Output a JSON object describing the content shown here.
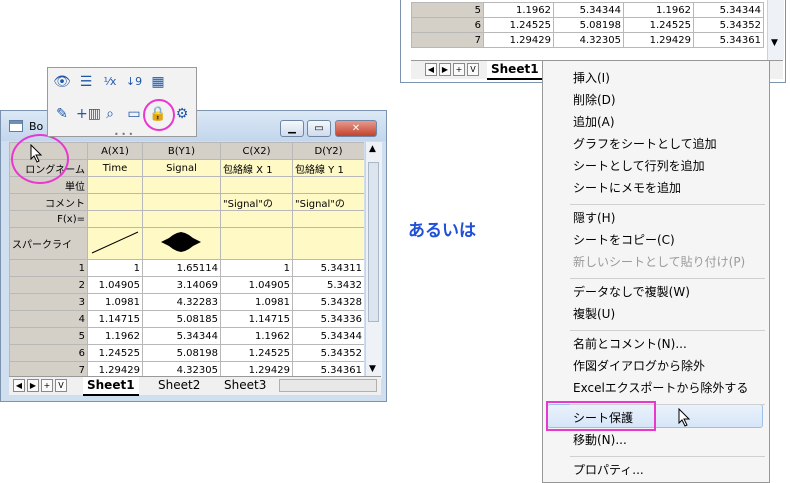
{
  "window": {
    "title_fragment": "Bo"
  },
  "columns": [
    {
      "header": "A(X1)"
    },
    {
      "header": "B(Y1)"
    },
    {
      "header": "C(X2)"
    },
    {
      "header": "D(Y2)"
    }
  ],
  "label_rows": [
    {
      "label": "ロングネーム",
      "a": "Time",
      "b": "Signal",
      "c": "包絡線 X 1",
      "d": "包絡線 Y 1"
    },
    {
      "label": "単位",
      "a": "",
      "b": "",
      "c": "",
      "d": ""
    },
    {
      "label": "コメント",
      "a": "",
      "b": "",
      "c": "\"Signal\"の",
      "d": "\"Signal\"の"
    },
    {
      "label": "F(x)=",
      "a": "",
      "b": "",
      "c": "",
      "d": ""
    }
  ],
  "sparkline_label": "スパークライ",
  "data_rows": [
    {
      "n": "1",
      "a": "1",
      "b": "1.65114",
      "c": "1",
      "d": "5.34311"
    },
    {
      "n": "2",
      "a": "1.04905",
      "b": "3.14069",
      "c": "1.04905",
      "d": "5.3432"
    },
    {
      "n": "3",
      "a": "1.0981",
      "b": "4.32283",
      "c": "1.0981",
      "d": "5.34328"
    },
    {
      "n": "4",
      "a": "1.14715",
      "b": "5.08185",
      "c": "1.14715",
      "d": "5.34336"
    },
    {
      "n": "5",
      "a": "1.1962",
      "b": "5.34344",
      "c": "1.1962",
      "d": "5.34344"
    },
    {
      "n": "6",
      "a": "1.24525",
      "b": "5.08198",
      "c": "1.24525",
      "d": "5.34352"
    },
    {
      "n": "7",
      "a": "1.29429",
      "b": "4.32305",
      "c": "1.29429",
      "d": "5.34361"
    }
  ],
  "sheet_tabs": [
    "Sheet1",
    "Sheet2",
    "Sheet3"
  ],
  "nav_buttons": [
    "◀",
    "▶",
    "+",
    "V"
  ],
  "top_sheet": {
    "rows": [
      {
        "n": "5",
        "a": "1.1962",
        "b": "5.34344",
        "c": "1.1962",
        "d": "5.34344"
      },
      {
        "n": "6",
        "a": "1.24525",
        "b": "5.08198",
        "c": "1.24525",
        "d": "5.34352"
      },
      {
        "n": "7",
        "a": "1.29429",
        "b": "4.32305",
        "c": "1.29429",
        "d": "5.34361"
      }
    ],
    "tab": "Sheet1"
  },
  "alternative_text": "あるいは",
  "context_menu": {
    "groups": [
      [
        "挿入(I)",
        "削除(D)",
        "追加(A)",
        "グラフをシートとして追加",
        "シートとして行列を追加",
        "シートにメモを追加"
      ],
      [
        "隠す(H)",
        "シートをコピー(C)",
        "新しいシートとして貼り付け(P)"
      ],
      [
        "データなしで複製(W)",
        "複製(U)"
      ],
      [
        "名前とコメント(N)...",
        "作図ダイアログから除外",
        "Excelエクスポートから除外する"
      ],
      [
        "シート保護",
        "移動(N)..."
      ],
      [
        "プロパティ..."
      ]
    ],
    "disabled": [
      "新しいシートとして貼り付け(P)"
    ],
    "highlighted": "シート保護"
  },
  "colors": {
    "accent_ring": "#e838d0",
    "alt_text": "#2050d8",
    "label_row_bg": "#fff9c6"
  }
}
